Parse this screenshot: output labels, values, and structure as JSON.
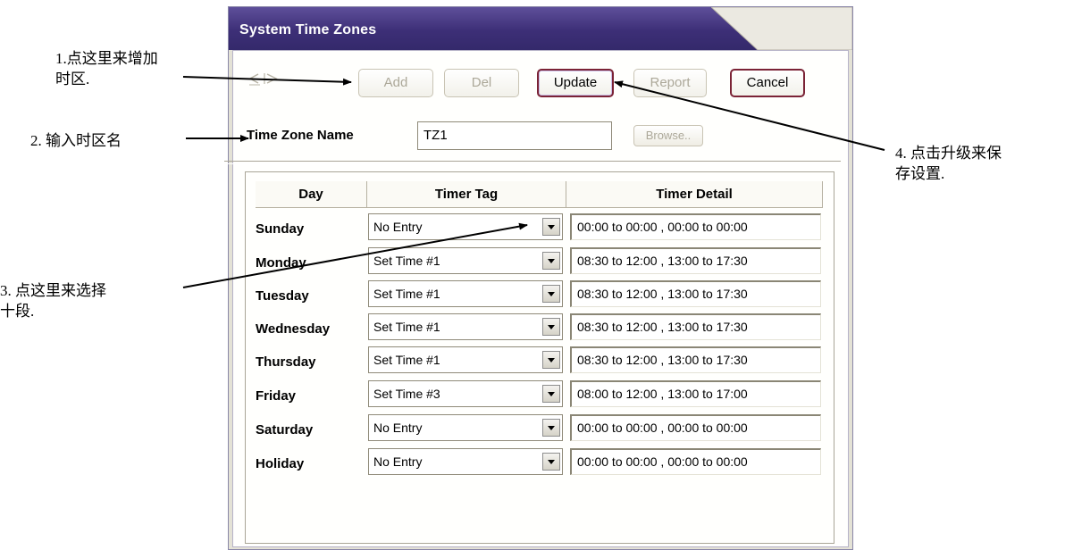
{
  "annotations": {
    "step1_line1": "1.点这里来增加",
    "step1_line2": "时区.",
    "step2": "2. 输入时区名",
    "step3_line1": "3. 点这里来选择",
    "step3_line2": "十段.",
    "step4_line1": "4. 点击升级来保",
    "step4_line2": "存设置."
  },
  "window": {
    "title": "System Time Zones"
  },
  "toolbar": {
    "add_label": "Add",
    "del_label": "Del",
    "update_label": "Update",
    "report_label": "Report",
    "cancel_label": "Cancel"
  },
  "time_zone": {
    "label": "Time Zone Name",
    "value": "TZ1",
    "browse_label": "Browse.."
  },
  "table": {
    "headers": [
      "Day",
      "Timer Tag",
      "Timer Detail"
    ],
    "rows": [
      {
        "day": "Sunday",
        "tag": "No Entry",
        "detail": "00:00 to 00:00 , 00:00 to 00:00"
      },
      {
        "day": "Monday",
        "tag": "Set Time #1",
        "detail": "08:30 to 12:00 , 13:00 to 17:30"
      },
      {
        "day": "Tuesday",
        "tag": "Set Time #1",
        "detail": "08:30 to 12:00 , 13:00 to 17:30"
      },
      {
        "day": "Wednesday",
        "tag": "Set Time #1",
        "detail": "08:30 to 12:00 , 13:00 to 17:30"
      },
      {
        "day": "Thursday",
        "tag": "Set Time #1",
        "detail": "08:30 to 12:00 , 13:00 to 17:30"
      },
      {
        "day": "Friday",
        "tag": "Set Time #3",
        "detail": "08:00 to 12:00 , 13:00 to 17:00"
      },
      {
        "day": "Saturday",
        "tag": "No Entry",
        "detail": "00:00 to 00:00 , 00:00 to 00:00"
      },
      {
        "day": "Holiday",
        "tag": "No Entry",
        "detail": "00:00 to 00:00 , 00:00 to 00:00"
      }
    ]
  },
  "colors": {
    "titlebar": "#3d2f77",
    "enabled_border": "#7b2336",
    "disabled_text": "#aca899",
    "window_bg": "#e4e2d6"
  }
}
